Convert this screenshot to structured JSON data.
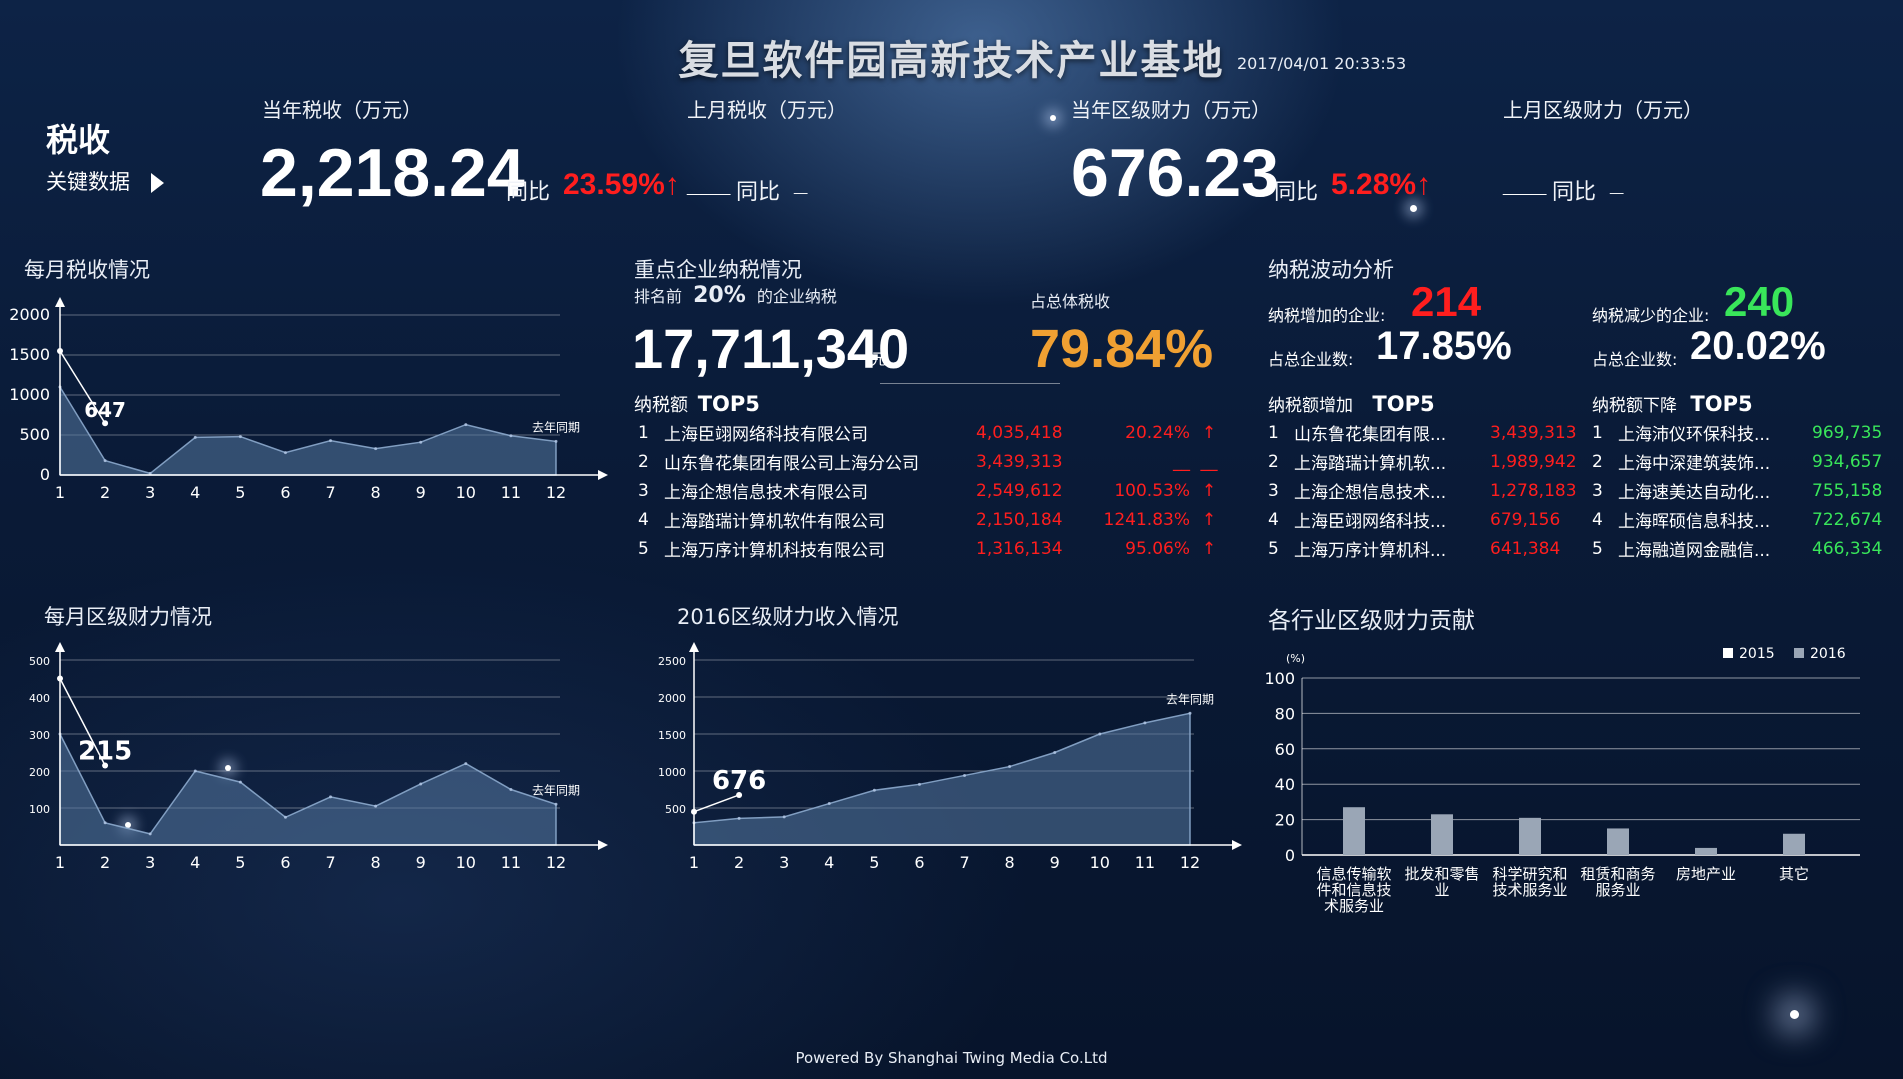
{
  "header": {
    "title": "复旦软件园高新技术产业基地",
    "datetime": "2017/04/01 20:33:53",
    "footer": "Powered By Shanghai Twing Media Co.Ltd"
  },
  "tax_block": {
    "heading": "税收",
    "subheading": "关键数据",
    "kpis": [
      {
        "label": "当年税收（万元）",
        "value": "2,218.24",
        "yoy_label": "同比",
        "yoy": "23.59%↑"
      },
      {
        "label": "上月税收（万元）",
        "value": "___",
        "yoy_label": "同比",
        "yoy": "_"
      },
      {
        "label": "当年区级财力（万元）",
        "value": "676.23",
        "yoy_label": "同比",
        "yoy": "5.28%↑"
      },
      {
        "label": "上月区级财力（万元）",
        "value": "___",
        "yoy_label": "同比",
        "yoy": "_"
      }
    ]
  },
  "key_enterprise": {
    "title": "重点企业纳税情况",
    "rank_prefix": "排名前",
    "rank_pct": "20%",
    "rank_suffix": "的企业纳税",
    "amount": "17,711,340",
    "unit": "元",
    "share_label": "占总体税收",
    "share": "79.84%",
    "top5_prefix": "纳税额",
    "top5_title": "TOP5",
    "rows": [
      {
        "rank": "1",
        "name": "上海臣翊网络科技有限公司",
        "amount": "4,035,418",
        "pct": "20.24%",
        "arrow": "↑"
      },
      {
        "rank": "2",
        "name": "山东鲁花集团有限公司上海分公司",
        "amount": "3,439,313",
        "pct": "__",
        "arrow": "__"
      },
      {
        "rank": "3",
        "name": "上海企想信息技术有限公司",
        "amount": "2,549,612",
        "pct": "100.53%",
        "arrow": "↑"
      },
      {
        "rank": "4",
        "name": "上海踏瑞计算机软件有限公司",
        "amount": "2,150,184",
        "pct": "1241.83%",
        "arrow": "↑"
      },
      {
        "rank": "5",
        "name": "上海万序计算机科技有限公司",
        "amount": "1,316,134",
        "pct": "95.06%",
        "arrow": "↑"
      }
    ]
  },
  "fluctuation": {
    "title": "纳税波动分析",
    "increase_label": "纳税增加的企业:",
    "increase_count": "214",
    "decrease_label": "纳税减少的企业:",
    "decrease_count": "240",
    "share_label": "占总企业数:",
    "increase_share": "17.85%",
    "decrease_share": "20.02%",
    "inc_top_prefix": "纳税额增加",
    "dec_top_prefix": "纳税额下降",
    "top_title": "TOP5",
    "increase_rows": [
      {
        "rank": "1",
        "name": "山东鲁花集团有限...",
        "amount": "3,439,313"
      },
      {
        "rank": "2",
        "name": "上海踏瑞计算机软...",
        "amount": "1,989,942"
      },
      {
        "rank": "3",
        "name": "上海企想信息技术...",
        "amount": "1,278,183"
      },
      {
        "rank": "4",
        "name": "上海臣翊网络科技...",
        "amount": "679,156"
      },
      {
        "rank": "5",
        "name": "上海万序计算机科...",
        "amount": "641,384"
      }
    ],
    "decrease_rows": [
      {
        "rank": "1",
        "name": "上海沛仪环保科技...",
        "amount": "969,735"
      },
      {
        "rank": "2",
        "name": "上海中深建筑装饰...",
        "amount": "934,657"
      },
      {
        "rank": "3",
        "name": "上海速美达自动化...",
        "amount": "755,158"
      },
      {
        "rank": "4",
        "name": "上海晖硕信息科技...",
        "amount": "722,674"
      },
      {
        "rank": "5",
        "name": "上海融道网金融信...",
        "amount": "466,334"
      }
    ]
  },
  "chart_data": [
    {
      "id": "monthly_tax",
      "type": "area",
      "title": "每月税收情况",
      "x": [
        1,
        2,
        3,
        4,
        5,
        6,
        7,
        8,
        9,
        10,
        11,
        12
      ],
      "series": [
        {
          "name": "去年同期",
          "values": [
            1100,
            180,
            20,
            470,
            480,
            280,
            430,
            330,
            410,
            630,
            490,
            420
          ]
        },
        {
          "values": [
            1550,
            647
          ]
        }
      ],
      "callout": "647",
      "legend_label": "去年同期",
      "ylim": [
        0,
        2000
      ],
      "yticks": [
        0,
        500,
        1000,
        1500,
        2000
      ]
    },
    {
      "id": "monthly_district",
      "type": "area",
      "title": "每月区级财力情况",
      "x": [
        1,
        2,
        3,
        4,
        5,
        6,
        7,
        8,
        9,
        10,
        11,
        12
      ],
      "series": [
        {
          "name": "去年同期",
          "values": [
            300,
            60,
            30,
            200,
            170,
            75,
            130,
            105,
            165,
            220,
            150,
            110
          ]
        },
        {
          "values": [
            450,
            215
          ]
        }
      ],
      "callout": "215",
      "legend_label": "去年同期",
      "ylim": [
        0,
        500
      ],
      "yticks": [
        100,
        200,
        300,
        400,
        500
      ]
    },
    {
      "id": "district_2016",
      "type": "area",
      "title": "2016区级财力收入情况",
      "x": [
        1,
        2,
        3,
        4,
        5,
        6,
        7,
        8,
        9,
        10,
        11,
        12
      ],
      "series": [
        {
          "name": "去年同期",
          "values": [
            300,
            360,
            380,
            560,
            740,
            820,
            940,
            1060,
            1250,
            1500,
            1650,
            1780
          ]
        },
        {
          "values": [
            450,
            676
          ]
        }
      ],
      "callout": "676",
      "legend_label": "去年同期",
      "ylim": [
        0,
        2500
      ],
      "yticks": [
        500,
        1000,
        1500,
        2000,
        2500
      ]
    },
    {
      "id": "industry",
      "type": "bar",
      "title": "各行业区级财力贡献",
      "unit": "(%)",
      "categories": [
        "信息传输软件和信息技术服务业",
        "批发和零售业",
        "科学研究和技术服务业",
        "租赁和商务服务业",
        "房地产业",
        "其它"
      ],
      "category_lines": [
        [
          "信息传输软",
          "件和信息技",
          "术服务业"
        ],
        [
          "批发和零售",
          "业"
        ],
        [
          "科学研究和",
          "技术服务业"
        ],
        [
          "租赁和商务",
          "服务业"
        ],
        [
          "房地产业"
        ],
        [
          "其它"
        ]
      ],
      "series": [
        {
          "name": "2015",
          "values": [
            0,
            0,
            0,
            0,
            0,
            0
          ]
        },
        {
          "name": "2016",
          "values": [
            27,
            23,
            21,
            15,
            4,
            12
          ]
        }
      ],
      "legend": [
        "2015",
        "2016"
      ],
      "ylim": [
        0,
        100
      ],
      "yticks": [
        0,
        20,
        40,
        60,
        80,
        100
      ]
    }
  ]
}
